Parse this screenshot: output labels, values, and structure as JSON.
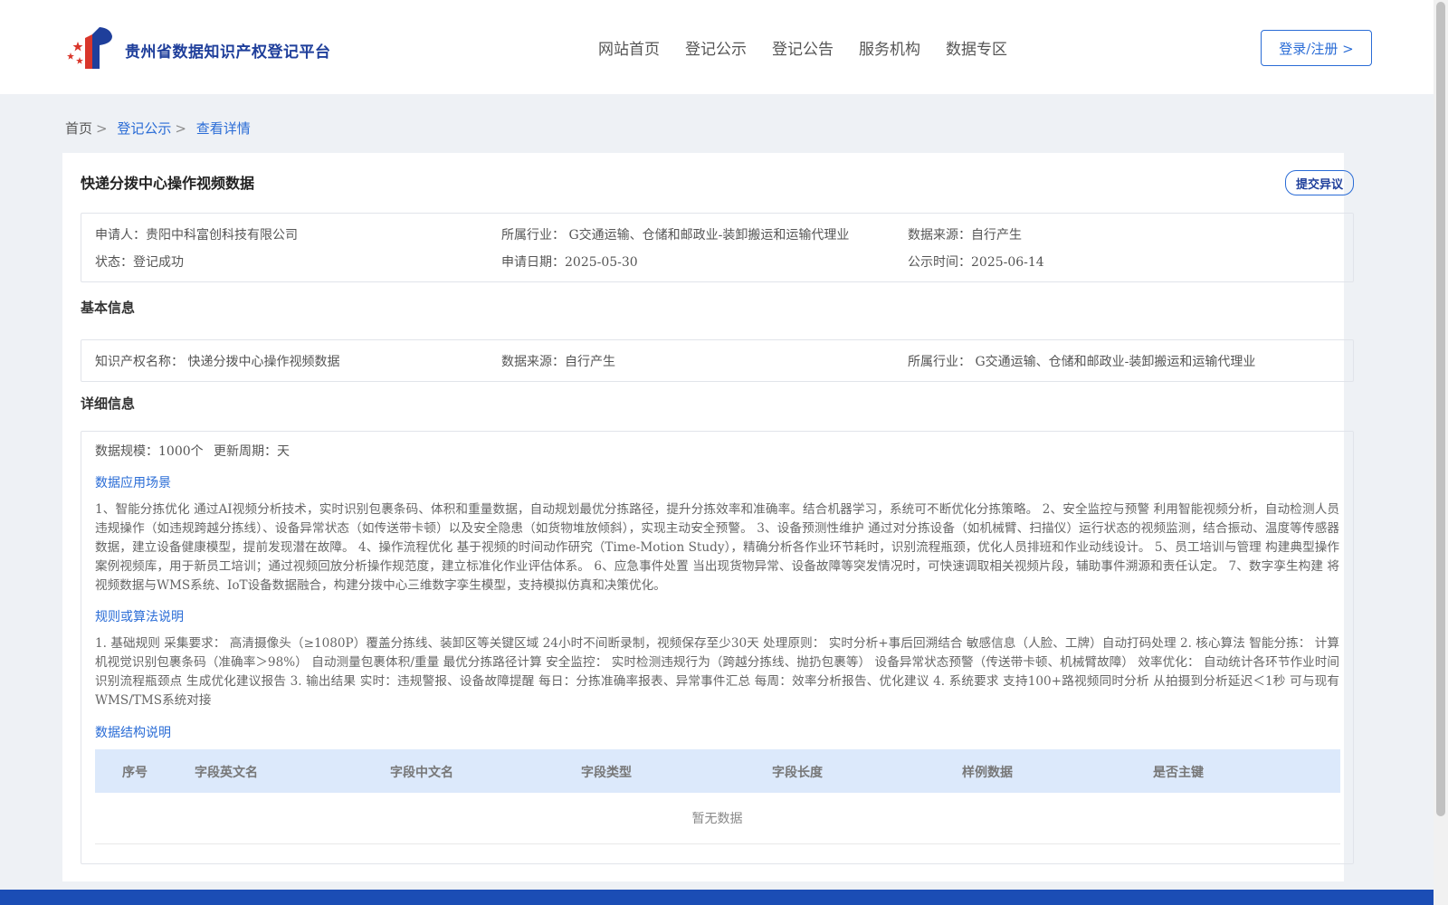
{
  "header": {
    "site_title": "贵州省数据知识产权登记平台",
    "nav": [
      "网站首页",
      "登记公示",
      "登记公告",
      "服务机构",
      "数据专区"
    ],
    "login_label": "登录/注册 >"
  },
  "breadcrumb": {
    "home": "首页",
    "separator": ">",
    "items": [
      "登记公示",
      "查看详情"
    ]
  },
  "record": {
    "title": "快递分拨中心操作视频数据",
    "objection_label": "提交异议",
    "summary": {
      "applicant_label": "申请人：",
      "applicant": "贵阳中科富创科技有限公司",
      "industry_label": "所属行业：",
      "industry": "G交通运输、仓储和邮政业-装卸搬运和运输代理业",
      "source_label": "数据来源：",
      "source": "自行产生",
      "status_label": "状态：",
      "status": "登记成功",
      "apply_date_label": "申请日期：",
      "apply_date": "2025-05-30",
      "publish_date_label": "公示时间：",
      "publish_date": "2025-06-14"
    }
  },
  "basic": {
    "section_title": "基本信息",
    "ip_name_label": "知识产权名称：",
    "ip_name": "快递分拨中心操作视频数据",
    "source_label": "数据来源：",
    "source": "自行产生",
    "industry_label": "所属行业：",
    "industry": "G交通运输、仓储和邮政业-装卸搬运和运输代理业"
  },
  "detail": {
    "section_title": "详细信息",
    "scale_label": "数据规模：",
    "scale": "1000个",
    "cycle_label": "更新周期：",
    "cycle": "天",
    "scenario_title": "数据应用场景",
    "scenario_text": "1、智能分拣优化 通过AI视频分析技术，实时识别包裹条码、体积和重量数据，自动规划最优分拣路径，提升分拣效率和准确率。结合机器学习，系统可不断优化分拣策略。 2、安全监控与预警 利用智能视频分析，自动检测人员违规操作（如违规跨越分拣线）、设备异常状态（如传送带卡顿）以及安全隐患（如货物堆放倾斜），实现主动安全预警。 3、设备预测性维护 通过对分拣设备（如机械臂、扫描仪）运行状态的视频监测，结合振动、温度等传感器数据，建立设备健康模型，提前发现潜在故障。 4、操作流程优化 基于视频的时间动作研究（Time-Motion Study），精确分析各作业环节耗时，识别流程瓶颈，优化人员排班和作业动线设计。 5、员工培训与管理 构建典型操作案例视频库，用于新员工培训；通过视频回放分析操作规范度，建立标准化作业评估体系。 6、应急事件处置 当出现货物异常、设备故障等突发情况时，可快速调取相关视频片段，辅助事件溯源和责任认定。 7、数字孪生构建 将视频数据与WMS系统、IoT设备数据融合，构建分拨中心三维数字孪生模型，支持模拟仿真和决策优化。",
    "rules_title": "规则或算法说明",
    "rules_text": "1. 基础规则 采集要求： 高清摄像头（≥1080P）覆盖分拣线、装卸区等关键区域 24小时不间断录制，视频保存至少30天 处理原则： 实时分析+事后回溯结合 敏感信息（人脸、工牌）自动打码处理 2. 核心算法 智能分拣： 计算机视觉识别包裹条码（准确率＞98%） 自动测量包裹体积/重量 最优分拣路径计算 安全监控： 实时检测违规行为（跨越分拣线、抛扔包裹等） 设备异常状态预警（传送带卡顿、机械臂故障） 效率优化： 自动统计各环节作业时间 识别流程瓶颈点 生成优化建议报告 3. 输出结果 实时：违规警报、设备故障提醒 每日：分拣准确率报表、异常事件汇总 每周：效率分析报告、优化建议 4. 系统要求 支持100+路视频同时分析 从拍摄到分析延迟＜1秒 可与现有WMS/TMS系统对接",
    "structure_title": "数据结构说明",
    "table_headers": [
      "序号",
      "字段英文名",
      "字段中文名",
      "字段类型",
      "字段长度",
      "样例数据",
      "是否主键"
    ],
    "empty_text": "暂无数据"
  },
  "colors": {
    "brand": "#1f3f9b",
    "link": "#2a6cd6",
    "table_header_bg": "#dce9fb",
    "footer": "#1b4db5"
  }
}
